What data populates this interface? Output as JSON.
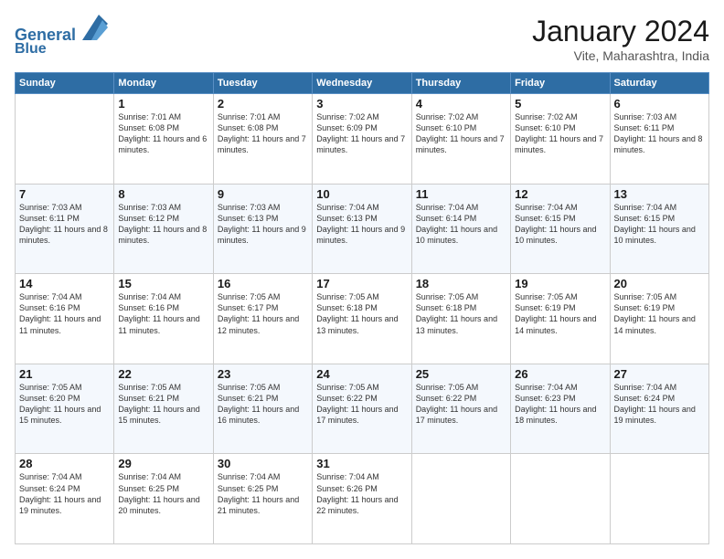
{
  "header": {
    "logo_line1": "General",
    "logo_line2": "Blue",
    "title": "January 2024",
    "subtitle": "Vite, Maharashtra, India"
  },
  "days_of_week": [
    "Sunday",
    "Monday",
    "Tuesday",
    "Wednesday",
    "Thursday",
    "Friday",
    "Saturday"
  ],
  "weeks": [
    [
      {
        "day": "",
        "sunrise": "",
        "sunset": "",
        "daylight": ""
      },
      {
        "day": "1",
        "sunrise": "7:01 AM",
        "sunset": "6:08 PM",
        "daylight": "11 hours and 6 minutes."
      },
      {
        "day": "2",
        "sunrise": "7:01 AM",
        "sunset": "6:08 PM",
        "daylight": "11 hours and 7 minutes."
      },
      {
        "day": "3",
        "sunrise": "7:02 AM",
        "sunset": "6:09 PM",
        "daylight": "11 hours and 7 minutes."
      },
      {
        "day": "4",
        "sunrise": "7:02 AM",
        "sunset": "6:10 PM",
        "daylight": "11 hours and 7 minutes."
      },
      {
        "day": "5",
        "sunrise": "7:02 AM",
        "sunset": "6:10 PM",
        "daylight": "11 hours and 7 minutes."
      },
      {
        "day": "6",
        "sunrise": "7:03 AM",
        "sunset": "6:11 PM",
        "daylight": "11 hours and 8 minutes."
      }
    ],
    [
      {
        "day": "7",
        "sunrise": "7:03 AM",
        "sunset": "6:11 PM",
        "daylight": "11 hours and 8 minutes."
      },
      {
        "day": "8",
        "sunrise": "7:03 AM",
        "sunset": "6:12 PM",
        "daylight": "11 hours and 8 minutes."
      },
      {
        "day": "9",
        "sunrise": "7:03 AM",
        "sunset": "6:13 PM",
        "daylight": "11 hours and 9 minutes."
      },
      {
        "day": "10",
        "sunrise": "7:04 AM",
        "sunset": "6:13 PM",
        "daylight": "11 hours and 9 minutes."
      },
      {
        "day": "11",
        "sunrise": "7:04 AM",
        "sunset": "6:14 PM",
        "daylight": "11 hours and 10 minutes."
      },
      {
        "day": "12",
        "sunrise": "7:04 AM",
        "sunset": "6:15 PM",
        "daylight": "11 hours and 10 minutes."
      },
      {
        "day": "13",
        "sunrise": "7:04 AM",
        "sunset": "6:15 PM",
        "daylight": "11 hours and 10 minutes."
      }
    ],
    [
      {
        "day": "14",
        "sunrise": "7:04 AM",
        "sunset": "6:16 PM",
        "daylight": "11 hours and 11 minutes."
      },
      {
        "day": "15",
        "sunrise": "7:04 AM",
        "sunset": "6:16 PM",
        "daylight": "11 hours and 11 minutes."
      },
      {
        "day": "16",
        "sunrise": "7:05 AM",
        "sunset": "6:17 PM",
        "daylight": "11 hours and 12 minutes."
      },
      {
        "day": "17",
        "sunrise": "7:05 AM",
        "sunset": "6:18 PM",
        "daylight": "11 hours and 13 minutes."
      },
      {
        "day": "18",
        "sunrise": "7:05 AM",
        "sunset": "6:18 PM",
        "daylight": "11 hours and 13 minutes."
      },
      {
        "day": "19",
        "sunrise": "7:05 AM",
        "sunset": "6:19 PM",
        "daylight": "11 hours and 14 minutes."
      },
      {
        "day": "20",
        "sunrise": "7:05 AM",
        "sunset": "6:19 PM",
        "daylight": "11 hours and 14 minutes."
      }
    ],
    [
      {
        "day": "21",
        "sunrise": "7:05 AM",
        "sunset": "6:20 PM",
        "daylight": "11 hours and 15 minutes."
      },
      {
        "day": "22",
        "sunrise": "7:05 AM",
        "sunset": "6:21 PM",
        "daylight": "11 hours and 15 minutes."
      },
      {
        "day": "23",
        "sunrise": "7:05 AM",
        "sunset": "6:21 PM",
        "daylight": "11 hours and 16 minutes."
      },
      {
        "day": "24",
        "sunrise": "7:05 AM",
        "sunset": "6:22 PM",
        "daylight": "11 hours and 17 minutes."
      },
      {
        "day": "25",
        "sunrise": "7:05 AM",
        "sunset": "6:22 PM",
        "daylight": "11 hours and 17 minutes."
      },
      {
        "day": "26",
        "sunrise": "7:04 AM",
        "sunset": "6:23 PM",
        "daylight": "11 hours and 18 minutes."
      },
      {
        "day": "27",
        "sunrise": "7:04 AM",
        "sunset": "6:24 PM",
        "daylight": "11 hours and 19 minutes."
      }
    ],
    [
      {
        "day": "28",
        "sunrise": "7:04 AM",
        "sunset": "6:24 PM",
        "daylight": "11 hours and 19 minutes."
      },
      {
        "day": "29",
        "sunrise": "7:04 AM",
        "sunset": "6:25 PM",
        "daylight": "11 hours and 20 minutes."
      },
      {
        "day": "30",
        "sunrise": "7:04 AM",
        "sunset": "6:25 PM",
        "daylight": "11 hours and 21 minutes."
      },
      {
        "day": "31",
        "sunrise": "7:04 AM",
        "sunset": "6:26 PM",
        "daylight": "11 hours and 22 minutes."
      },
      {
        "day": "",
        "sunrise": "",
        "sunset": "",
        "daylight": ""
      },
      {
        "day": "",
        "sunrise": "",
        "sunset": "",
        "daylight": ""
      },
      {
        "day": "",
        "sunrise": "",
        "sunset": "",
        "daylight": ""
      }
    ]
  ],
  "labels": {
    "sunrise_prefix": "Sunrise: ",
    "sunset_prefix": "Sunset: ",
    "daylight_prefix": "Daylight: "
  }
}
